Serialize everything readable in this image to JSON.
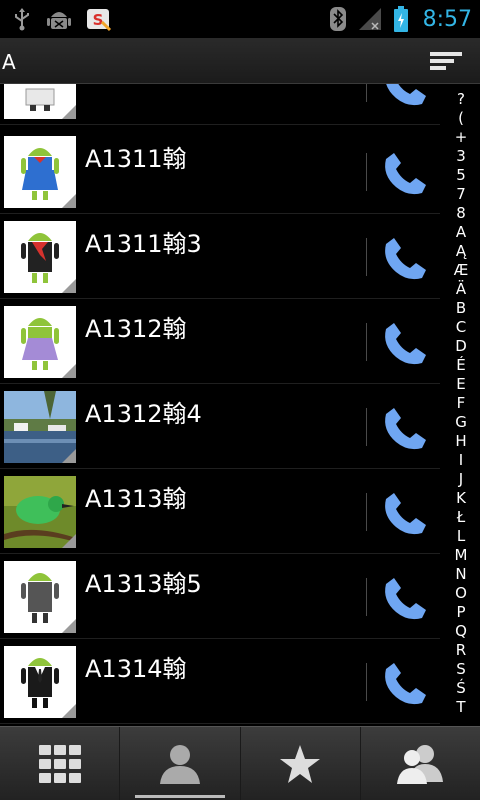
{
  "status_bar": {
    "time": "8:57",
    "icons": [
      "usb-icon",
      "android-debug-icon",
      "app-notification-icon",
      "bluetooth-icon",
      "no-signal-icon",
      "battery-charging-icon"
    ]
  },
  "header": {
    "title": "A",
    "menu_icon": "sort-menu-icon"
  },
  "contacts": [
    {
      "name": "",
      "avatar": "android-partial-icon"
    },
    {
      "name": "A1311翰",
      "avatar": "android-blue-dress-icon"
    },
    {
      "name": "A1311翰3",
      "avatar": "android-red-scarf-icon"
    },
    {
      "name": "A1312翰",
      "avatar": "android-purple-dress-icon"
    },
    {
      "name": "A1312翰4",
      "avatar": "lake-photo"
    },
    {
      "name": "A1313翰",
      "avatar": "bird-photo"
    },
    {
      "name": "A1313翰5",
      "avatar": "android-gray-icon"
    },
    {
      "name": "A1314翰",
      "avatar": "android-suit-icon"
    }
  ],
  "alphabet_index": [
    "?",
    "(",
    "+",
    "3",
    "5",
    "7",
    "8",
    "A",
    "Ą",
    "Æ",
    "Ä",
    "B",
    "C",
    "D",
    "É",
    "E",
    "F",
    "G",
    "H",
    "I",
    "J",
    "K",
    "Ł",
    "L",
    "M",
    "N",
    "O",
    "P",
    "Q",
    "R",
    "S",
    "Ś",
    "T"
  ],
  "tabs": [
    {
      "icon": "dialpad-icon",
      "active": false
    },
    {
      "icon": "contacts-icon",
      "active": true
    },
    {
      "icon": "favorites-star-icon",
      "active": false
    },
    {
      "icon": "groups-icon",
      "active": false
    }
  ],
  "colors": {
    "accent": "#33b5e5",
    "call_icon": "#6fa6f2"
  }
}
